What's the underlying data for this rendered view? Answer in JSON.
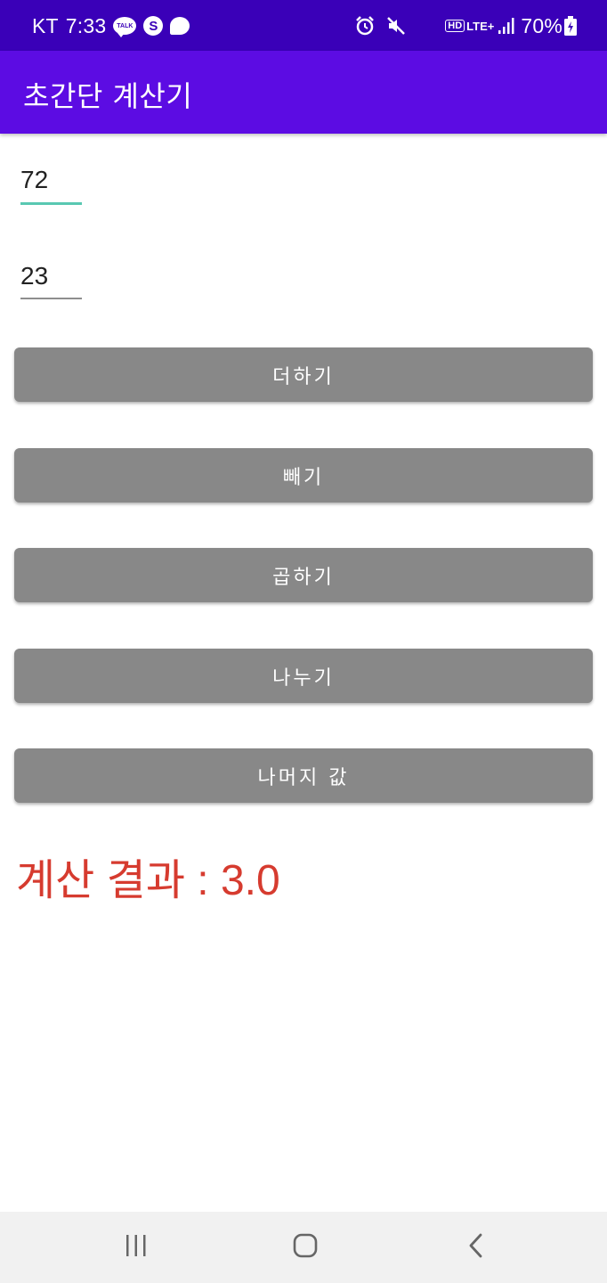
{
  "status_bar": {
    "carrier": "KT",
    "time": "7:33",
    "talk_icon_label": "TALK",
    "s_icon_label": "S",
    "hd": "HD",
    "lte": "LTE+",
    "battery": "70%",
    "background": "#3a00b8",
    "icons": [
      "kakaotalk-icon",
      "s-icon",
      "message-bubble-icon",
      "alarm-icon",
      "mute-icon",
      "signal-icon",
      "battery-icon"
    ]
  },
  "app_bar": {
    "title": "초간단 계산기",
    "background": "#5c0ce3"
  },
  "inputs": {
    "first_value": "72",
    "second_value": "23",
    "focused_underline_color": "#59c8b2"
  },
  "buttons": {
    "add": "더하기",
    "subtract": "빼기",
    "multiply": "곱하기",
    "divide": "나누기",
    "remainder": "나머지 값",
    "color": "#888888"
  },
  "result": {
    "text": "계산 결과 : 3.0",
    "color": "#d63b2f"
  },
  "nav_bar": {
    "icons": [
      "recent-apps-icon",
      "home-icon",
      "back-icon"
    ]
  }
}
